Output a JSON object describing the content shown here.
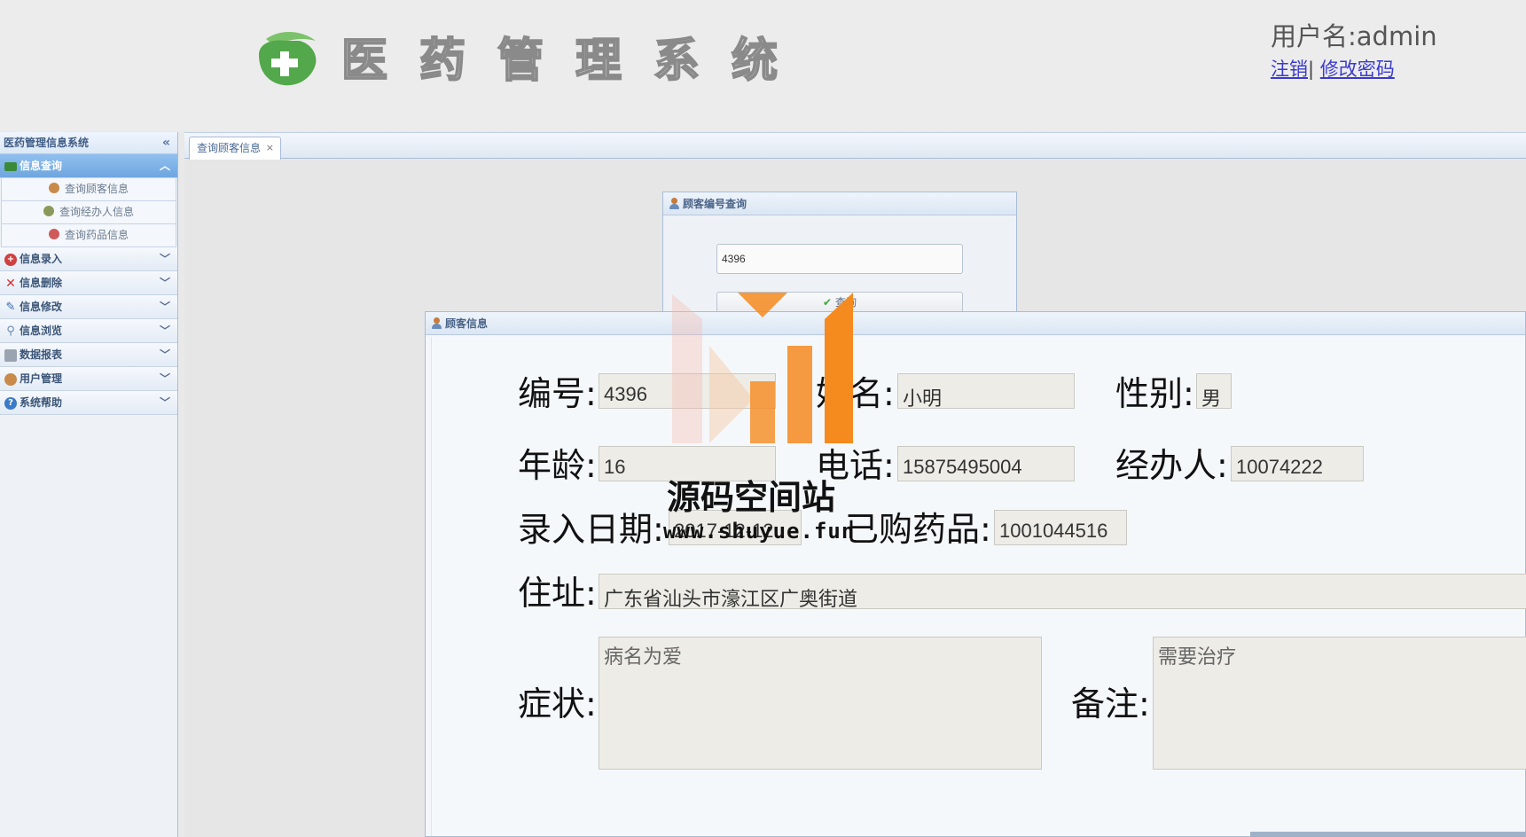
{
  "header": {
    "logo_chars": [
      "医",
      "药",
      "管",
      "理",
      "系",
      "统"
    ],
    "user_label": "用户名:admin",
    "logout_link": "注销",
    "separator": "|",
    "change_password_link": "修改密码"
  },
  "sidebar": {
    "title": "医药管理信息系统",
    "sections": [
      {
        "label": "信息查询",
        "icon": "folder-icon",
        "active": true,
        "items": [
          {
            "label": "查询顾客信息",
            "icon": "person-icon"
          },
          {
            "label": "查询经办人信息",
            "icon": "people-icon"
          },
          {
            "label": "查询药品信息",
            "icon": "pill-icon"
          }
        ]
      },
      {
        "label": "信息录入",
        "icon": "add-icon"
      },
      {
        "label": "信息删除",
        "icon": "delete-icon"
      },
      {
        "label": "信息修改",
        "icon": "pencil-icon"
      },
      {
        "label": "信息浏览",
        "icon": "magnifier-icon"
      },
      {
        "label": "数据报表",
        "icon": "printer-icon"
      },
      {
        "label": "用户管理",
        "icon": "user-icon"
      },
      {
        "label": "系统帮助",
        "icon": "help-icon"
      }
    ]
  },
  "tabs": [
    {
      "label": "查询顾客信息",
      "close": "×"
    }
  ],
  "search_panel": {
    "title": "顾客编号查询",
    "input_value": "4396",
    "button_label": "查询"
  },
  "info_panel": {
    "title": "顾客信息",
    "fields": {
      "id": {
        "label": "编号:",
        "value": "4396"
      },
      "name": {
        "label": "姓名:",
        "value": "小明"
      },
      "gender": {
        "label": "性别:",
        "value": "男"
      },
      "age": {
        "label": "年龄:",
        "value": "16"
      },
      "phone": {
        "label": "电话:",
        "value": "15875495004"
      },
      "agent": {
        "label": "经办人:",
        "value": "10074222"
      },
      "entry_date": {
        "label": "录入日期:",
        "value": "2017-12-12"
      },
      "purchased": {
        "label": "已购药品:",
        "value": "1001044516"
      },
      "address": {
        "label": "住址:",
        "value": "广东省汕头市濠江区广奥街道"
      },
      "symptom": {
        "label": "症状:",
        "value": "病名为爱"
      },
      "remark": {
        "label": "备注:",
        "value": "需要治疗"
      }
    }
  },
  "watermark": {
    "title": "源码空间站",
    "url": "www.shuyue.fun"
  },
  "colors": {
    "accent_blue": "#6fa6df",
    "logo_green": "#4caf50",
    "watermark_orange": "#f58a1e"
  }
}
